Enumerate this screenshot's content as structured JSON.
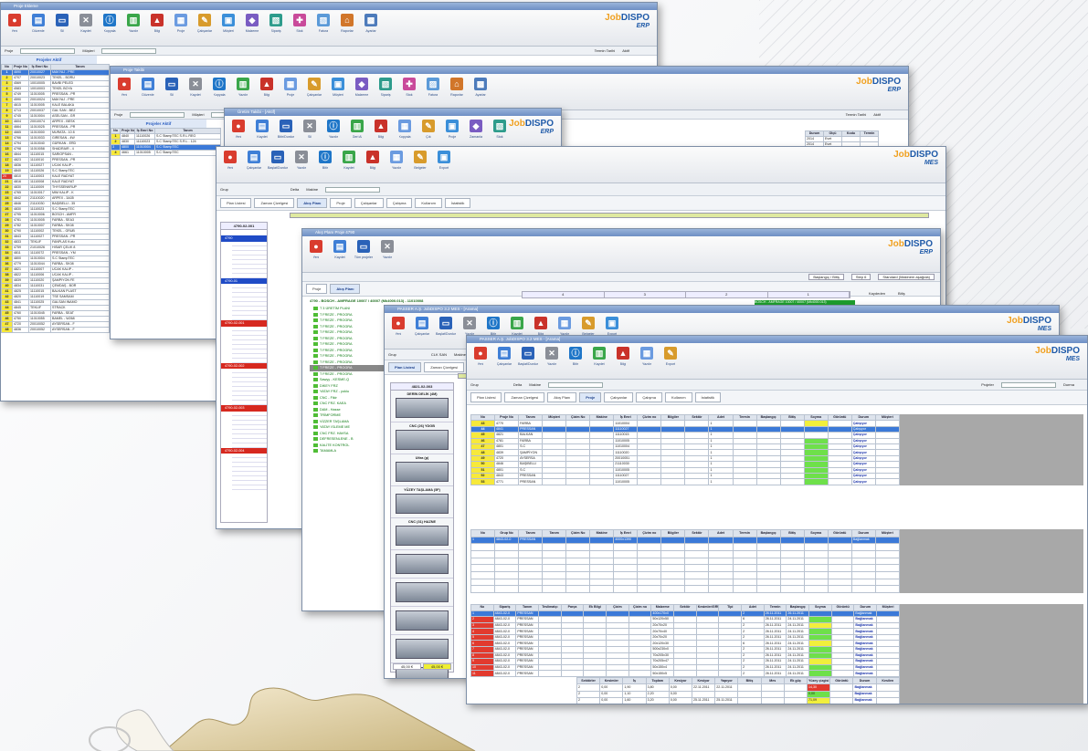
{
  "brand": {
    "dispo_prefix": "Job",
    "dispo_main": "DISPO",
    "erp": "ERP",
    "mes": "MES"
  },
  "w1": {
    "title": "Proje Ekleme",
    "toolbar": [
      "Yeni",
      "Düzenle",
      "Sil",
      "Kaydet",
      "Kopyala",
      "Yazdır",
      "Bilgi",
      "Proje",
      "Çalışanlar",
      "Müşteri",
      "Malzeme",
      "Sipariş",
      "Stok",
      "Fatura",
      "Raporlar",
      "Ayarlar"
    ],
    "filter": {
      "project": "Proje",
      "customer": "Müşteri",
      "term": "Termin Tarihi",
      "active": "Aktif"
    },
    "grid_title": "Projeler Aktif",
    "headers": [
      "No",
      "Proje No",
      "İş Emri No",
      "Tanım"
    ],
    "rows": [
      [
        "1",
        "4690",
        "20010027",
        "MAKYAJ - PRE"
      ],
      [
        "2",
        "4707",
        "20010023",
        "TEKEL - BORU"
      ],
      [
        "3",
        "4569",
        "10010005",
        "BAVBİ PELED"
      ],
      [
        "4",
        "4583",
        "10010003",
        "TEKEL BOYA"
      ],
      [
        "5",
        "4749",
        "11010005",
        "PRESSAN - PR"
      ],
      [
        "6",
        "4590",
        "20010024",
        "MAKYAJ - PRE"
      ],
      [
        "7",
        "4615",
        "11010005",
        "KALE BALAKA"
      ],
      [
        "8",
        "4713",
        "20010037",
        "GAL SAN - BEZ"
      ],
      [
        "9",
        "4745",
        "11010004",
        "ASELSAN - GR"
      ],
      [
        "10",
        "4604",
        "20010074",
        "ARPEX - BESK"
      ],
      [
        "11",
        "4664",
        "11010025",
        "PRESSAN - PR"
      ],
      [
        "12",
        "4665",
        "11010000",
        "MURATA - 10 8"
      ],
      [
        "13",
        "4766",
        "11010033",
        "GİRESAN - 4W"
      ],
      [
        "14",
        "4794",
        "11010040",
        "GÜRKAN - ERD"
      ],
      [
        "15",
        "4798",
        "11010058",
        "SHADRAIR - 4"
      ],
      [
        "16",
        "4844",
        "11110015",
        "SARIOPSAN -"
      ],
      [
        "17",
        "4823",
        "11110010",
        "PRESSAN - PR"
      ],
      [
        "18",
        "4836",
        "11110027",
        "UCAK KALIP -"
      ],
      [
        "19",
        "4840",
        "11110026",
        "S.C StampTEC"
      ],
      [
        "20",
        "4810",
        "11110003",
        "KALE RADYAT"
      ],
      [
        "21",
        "4816",
        "11110008",
        "KALE RADYAT"
      ],
      [
        "22",
        "4830",
        "11110009",
        "THYSSENKRUP"
      ],
      [
        "23",
        "4765",
        "11010017",
        "MIM KALIP - K"
      ],
      [
        "24",
        "4842",
        "21110020",
        "ARPEX - 3A35"
      ],
      [
        "25",
        "4846",
        "21110030",
        "BAŞIBELLI - 35"
      ],
      [
        "26",
        "4830",
        "11110023",
        "S.C StampTEC"
      ],
      [
        "27",
        "4795",
        "11010006",
        "BOSCH - AMFR"
      ],
      [
        "28",
        "4781",
        "11010005",
        "FARBA - SEA3"
      ],
      [
        "29",
        "4782",
        "11010007",
        "FARBA - SK08"
      ],
      [
        "30",
        "4790",
        "11110002",
        "TEKEL - GRUB"
      ],
      [
        "31",
        "4843",
        "11110027",
        "PRESSAN - PR"
      ],
      [
        "32",
        "4833",
        "TEKLIF",
        "FANPLAS Kutu"
      ],
      [
        "33",
        "4759",
        "21010026",
        "HİSAR ÇELİK 8"
      ],
      [
        "34",
        "4811",
        "11110072",
        "PRESSAN - YM"
      ],
      [
        "35",
        "4800",
        "11010004",
        "S.C StampTEC"
      ],
      [
        "36",
        "4779",
        "11010044",
        "FARBA - SK08"
      ],
      [
        "37",
        "4821",
        "11110007",
        "UCAK KALIP -"
      ],
      [
        "38",
        "4822",
        "11110006",
        "UCAK KALIP -"
      ],
      [
        "39",
        "4839",
        "11110020",
        "ŞAMPİYON FE"
      ],
      [
        "40",
        "4834",
        "11110031",
        "ÇEMDAŞ - BOR"
      ],
      [
        "41",
        "4825",
        "11110015",
        "BALKAN PLAST"
      ],
      [
        "42",
        "4820",
        "11110019",
        "TSE SAMSAM"
      ],
      [
        "43",
        "4841",
        "11110025",
        "GALSAN INAMO"
      ],
      [
        "44",
        "4845",
        "TEKLIF",
        "STRACK"
      ],
      [
        "45",
        "4760",
        "11010045",
        "FARBA - SEAT"
      ],
      [
        "46",
        "4750",
        "11010055",
        "BAMEL - W268"
      ],
      [
        "47",
        "4720",
        "20010052",
        "AYSERSAN - F"
      ],
      [
        "48",
        "4836",
        "20010052",
        "AYSERSAN - F"
      ]
    ]
  },
  "w2": {
    "title": "Proje Takibi",
    "grid_title": "Projeler Aktif",
    "headers": [
      "No",
      "Proje No",
      "İş Emri No",
      "Tanım"
    ],
    "rows": [
      [
        "1",
        "4840",
        "11110026",
        "S.C StampTEC S.R.L REG"
      ],
      [
        "2",
        "4830",
        "11110023",
        "S.C StampTEC S.R.L - 124"
      ],
      [
        "3",
        "4800",
        "11010004",
        "S.C StampTEC"
      ],
      [
        "4",
        "4661",
        "11010005",
        "S.C StampTEC"
      ]
    ],
    "right_headers": [
      "Durum",
      "Ölçü",
      "Kodu",
      "Termin"
    ],
    "right_rows": [
      [
        "2014",
        "Evet",
        "",
        ""
      ],
      [
        "2014",
        "Evet",
        "",
        ""
      ],
      [
        "2014",
        "Evet",
        "",
        ""
      ]
    ]
  },
  "w3": {
    "title": "Üretim Takibi - [Aktif]",
    "toolbar": [
      "Yeni",
      "Kaydet",
      "Bitir/Durdur",
      "Sil",
      "Yazdır",
      "Geri Al",
      "Bilgi",
      "Kopyala",
      "Çık",
      "Proje",
      "Zamanla",
      "Stok"
    ]
  },
  "w4": {
    "title": "PASSER A.Ş. JobDISPO 3.2 MES - [Arama]",
    "toolbar": [
      "Yeni",
      "Çalışanlar",
      "Başlat/Durdur",
      "Yazdır",
      "Bitir",
      "Kaydet",
      "Bilgi",
      "Yazdır",
      "Belgeler",
      "Export"
    ],
    "filter": {
      "group": "Grup",
      "val": "Delta",
      "machine": "Makine",
      "search": "Ara"
    },
    "tabs": [
      "Plan Listesi",
      "Zaman Çizelgesi",
      "Akış Planı",
      "Proje",
      "Çalışanlar",
      "Çalışma",
      "Kullanım",
      "İstatistik"
    ],
    "tree_header": "4790-02-001",
    "tree": [
      "4790",
      "4790-01",
      "4790-02-001",
      "4790-02-002",
      "4790-02-003",
      "4790-02-004"
    ]
  },
  "w5": {
    "title": "Akış Planı Proje 4790",
    "toolbar": [
      "Yeni",
      "Kaydet",
      "Tüm projeler",
      "Yazdır"
    ],
    "controls": {
      "mode": "Başlangıç / Bitiş",
      "step": "Step 6",
      "std": "Standard (Makinem aşağıda)"
    },
    "tabs": [
      "Proje",
      "Akış Planı"
    ],
    "headline": "4790 - BOSCH - AMFRAGE 10007 / 40007 (Mk4000.013) - 11010008",
    "tree": [
      "T 3 ÜRETİM PLANI",
      "T FREZE - PROGRA",
      "T FREZE - PROGRA",
      "T FREZE - PROGRA",
      "T FREZE - PROGRA",
      "T FREZE - PROGRA",
      "T FREZE - PROGRA",
      "T FREZE - PROGRA",
      "T FREZE - PROGRA",
      "T FREZE - PROGRA",
      "T FREZE - PROGRA",
      "T FREZE - PROGRA"
    ],
    "cols": [
      "4",
      "3",
      "2",
      "1"
    ],
    "banner": "BOSCH - AMFRAGE 10007 / 40007 (Mk4000.013)",
    "extra": [
      "Kaydeden",
      "Bitiş"
    ],
    "ops": [
      "Sawyy - KESME-Q",
      "DİKEY FRZ",
      "YATAY FRZ - yoklu",
      "CNC - Fikir",
      "CNC FRZ. KAEA",
      "DAM - Hasse",
      "TRİMFORME",
      "VİZZER TAŞLAMA",
      "YATAY ISLEME ME",
      "CNC FRZ. HAVSA",
      "DEFRESENLENE - B",
      "KALİTE KONTROL",
      "TAMAMLA"
    ]
  },
  "w6": {
    "title": "PASSER A.Ş. JobDISPO 3.2 MES - [Arama]",
    "toolbar": [
      "Yeni",
      "Çalışanlar",
      "Başlat/Durdur",
      "Yazdır",
      "Bitir",
      "Kaydet",
      "Bilgi",
      "Yazdır",
      "Belgeler",
      "Export"
    ],
    "filter": {
      "group": "Grup",
      "val": "CLK SAN",
      "machine": "Makine",
      "staff": "Çalışanlar",
      "search": "Ara",
      "term": "Son tarih"
    },
    "tabs": [
      "Plan Listesi",
      "Zaman Çizelgesi",
      "Akış Planı",
      "Proje",
      "Çalışanlar",
      "Çalışma",
      "Kullanım",
      "İstatistik"
    ],
    "machine_header": "4821-02-003",
    "machines": [
      "DERİN DELİK (4M)",
      "CNC (26) YDGB",
      "Ultra (p)",
      "YÜZEY TAŞLAMA (5F)",
      "CNC (31) HAZNE",
      "",
      "",
      "",
      "",
      ""
    ],
    "bottom": {
      "left": "45,00 €",
      "right": "45,00 €"
    },
    "tree_items": [
      "4790-01",
      "Sawyy - KESME-Q",
      "DİKEY FRZ",
      "YATAY FRZ",
      "4790-02-001",
      "4790-02-002",
      "4790-02-003"
    ]
  },
  "w7": {
    "title": "PASSER A.Ş. JobDISPO 3.2 MES - [Arama]",
    "toolbar": [
      "Yeni",
      "Çalışanlar",
      "Başlat/Durdur",
      "Yazdır",
      "Bitir",
      "Kaydet",
      "Bilgi",
      "Yazdır",
      "Export"
    ],
    "filter": {
      "group": "Grup",
      "val": "Delta",
      "machine": "Makine",
      "projects": "Projeler",
      "stop": "Durma"
    },
    "tabs": [
      "Plan Listesi",
      "Zaman Çizelgesi",
      "Akış Planı",
      "Proje",
      "Çalışanlar",
      "Çalışma",
      "Kullanım",
      "İstatistik"
    ],
    "proj_headers": [
      "No",
      "Proje No",
      "Tanım",
      "Müşteri",
      "Çizim No",
      "Makine",
      "İş Emri",
      "Çizim no",
      "Bilgiler",
      "Sektör",
      "Adet",
      "Termin",
      "Başlangıç",
      "Bitiş",
      "Soyma",
      "Görüntü",
      "Durum",
      "Müşteri"
    ],
    "proj_rows": [
      {
        "no": "43",
        "p": "4770",
        "t": "FARBA",
        "ie": "11010004",
        "st": "Çalışıyor",
        "c": "yel"
      },
      {
        "no": "44",
        "p": "4841",
        "t": "PRESSAN",
        "ie": "11110027",
        "st": "Çalışıyor",
        "c": "sel"
      },
      {
        "no": "45",
        "p": "4821",
        "t": "BALKAN",
        "ie": "11110015",
        "st": "Çalışıyor",
        "c": ""
      },
      {
        "no": "46",
        "p": "4781",
        "t": "FARBA",
        "ie": "11010005",
        "st": "Çalışıyor",
        "c": "grn"
      },
      {
        "no": "47",
        "p": "4801",
        "t": "S.C",
        "ie": "11010004",
        "st": "Çalışıyor",
        "c": "grn"
      },
      {
        "no": "48",
        "p": "4839",
        "t": "ŞAMPİYON",
        "ie": "11110020",
        "st": "Çalışıyor",
        "c": "grn"
      },
      {
        "no": "49",
        "p": "4720",
        "t": "AYSERSA",
        "ie": "20010051",
        "st": "Çalışıyor",
        "c": "grn"
      },
      {
        "no": "50",
        "p": "4846",
        "t": "BAŞIBELLI",
        "ie": "21110030",
        "st": "Çalışıyor",
        "c": "grn"
      },
      {
        "no": "51",
        "p": "4801",
        "t": "S.C",
        "ie": "11010005",
        "st": "Çalışıyor",
        "c": "grn"
      },
      {
        "no": "52",
        "p": "4843",
        "t": "PRESSAN",
        "ie": "11110027",
        "st": "Çalışıyor",
        "c": "grn"
      },
      {
        "no": "53",
        "p": "4771",
        "t": "PRESSAN",
        "ie": "11010005",
        "st": "Çalışıyor",
        "c": "grn"
      }
    ],
    "plan_headers": [
      "No",
      "Grup No",
      "Tanım",
      "Tanım",
      "Çizim No",
      "Makine",
      "İş Emri",
      "Çizim no",
      "Bilgiler",
      "Sektör",
      "Adet",
      "Termin",
      "Başlangıç",
      "Bitiş",
      "Soyma",
      "Görüntü",
      "Durum",
      "Müşteri"
    ],
    "plan_row": {
      "no": "1",
      "g": "4843-02-0",
      "t": "PRESSAN",
      "ie": "4000x1390",
      "st": "Bağlanmak"
    },
    "op_headers": [
      "No",
      "Sipariş",
      "Tanım",
      "Teslimatçı",
      "Parça",
      "Ek Bilgi",
      "Çizim",
      "Çizim no",
      "Malzeme",
      "Sektör",
      "Kesimler/GRUP",
      "Tipi",
      "Adet",
      "Termin",
      "Başlangıç",
      "Soyma",
      "Görüntü",
      "Durum",
      "Müşteri"
    ],
    "op_rows": [
      {
        "no": "1",
        "s": "4843-02-0",
        "t": "PRESSAN",
        "m": "400x170x0",
        "a": "2",
        "tr": "26.11.2011",
        "b": "26.11.2011",
        "st": "Bağlanmak",
        "sel": true
      },
      {
        "no": "2",
        "s": "4843-02-0",
        "t": "PRESSAN",
        "m": "50x120x50",
        "a": "6",
        "tr": "26.11.2011",
        "b": "24.11.2011",
        "st": "Bağlanmak"
      },
      {
        "no": "3",
        "s": "4843-02-0",
        "t": "PRESSAN",
        "m": "20x70x20",
        "a": "2",
        "tr": "26.11.2011",
        "b": "24.11.2011",
        "st": "Bağlanmak"
      },
      {
        "no": "4",
        "s": "4843-02-0",
        "t": "PRESSAN",
        "m": "20x70x40",
        "a": "2",
        "tr": "26.11.2011",
        "b": "24.11.2011",
        "st": "Bağlanmak"
      },
      {
        "no": "5",
        "s": "4843-02-0",
        "t": "PRESSAN",
        "m": "20x70x20",
        "a": "2",
        "tr": "26.11.2011",
        "b": "24.11.2011",
        "st": "Bağlanmak"
      },
      {
        "no": "6",
        "s": "4843-02-0",
        "t": "PRESSAN",
        "m": "20x120x30",
        "a": "6",
        "tr": "26.11.2011",
        "b": "24.11.2011",
        "st": "Bağlanmak"
      },
      {
        "no": "7",
        "s": "4843-02-0",
        "t": "PRESSAN",
        "m": "500x230x0",
        "a": "2",
        "tr": "26.11.2011",
        "b": "24.11.2011",
        "st": "Bağlanmak"
      },
      {
        "no": "8",
        "s": "4843-02-0",
        "t": "PRESSAN",
        "m": "70x205x30",
        "a": "2",
        "tr": "26.11.2011",
        "b": "24.11.2011",
        "st": "Bağlanmak"
      },
      {
        "no": "9",
        "s": "4843-02-0",
        "t": "PRESSAN",
        "m": "70x205x47",
        "a": "2",
        "tr": "26.11.2011",
        "b": "24.11.2011",
        "st": "Bağlanmak"
      },
      {
        "no": "10",
        "s": "4843-02-0",
        "t": "PRESSAN",
        "m": "50x150x4",
        "a": "2",
        "tr": "26.11.2011",
        "b": "24.11.2011",
        "st": "Bağlanmak"
      },
      {
        "no": "11",
        "s": "4843-02-0",
        "t": "PRESSAN",
        "m": "50x150x5",
        "a": "2",
        "tr": "26.11.2011",
        "b": "24.11.2011",
        "st": "Bağlanmak"
      }
    ],
    "ex_headers": [
      "Sektörler",
      "Kesimler",
      "İş",
      "Toplam",
      "Kesiyor",
      "Kesiyor",
      "Yapıyor",
      "Bitiş",
      "Mes",
      "Ek güç",
      "Yüzey çizgisi",
      "Görüntü",
      "Durum",
      "Kesilen"
    ],
    "ex_rows": [
      {
        "a": "2",
        "b": "0,00",
        "c": "1,90",
        "d": "3,80",
        "e": "0,00",
        "f": "22.11.2011",
        "g": "22.11.2011",
        "h": "14,30",
        "st": "Bağlanmak",
        "c2": "red"
      },
      {
        "a": "2",
        "b": "0,00",
        "c": "1,10",
        "d": "2,20",
        "e": "0,00",
        "f": "",
        "g": "",
        "h": "0,00",
        "st": "Bağlanmak",
        "c2": "grn"
      },
      {
        "a": "2",
        "b": "0,00",
        "c": "1,60",
        "d": "3,20",
        "e": "0,00",
        "f": "25.11.2011",
        "g": "25.11.2011",
        "h": "71,09",
        "st": "Bağlanmak",
        "c2": "yel"
      }
    ]
  }
}
